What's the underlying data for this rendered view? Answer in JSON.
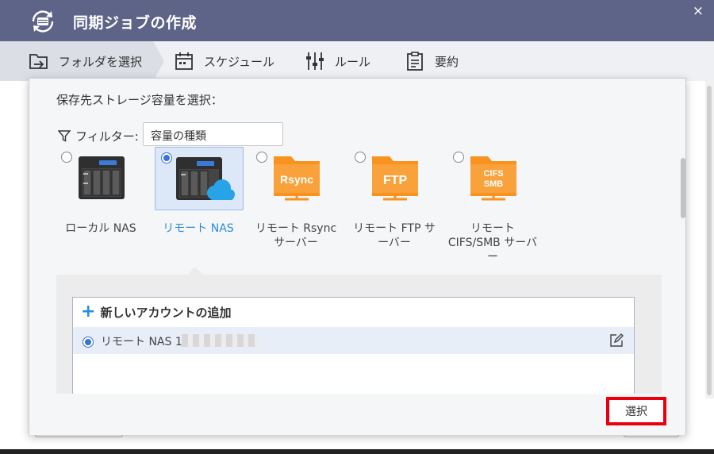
{
  "window": {
    "title": "同期ジョブの作成",
    "close_glyph": "×"
  },
  "steps": [
    {
      "label": "フォルダを選択",
      "icon": "folder-select-icon",
      "active": true
    },
    {
      "label": "スケジュール",
      "icon": "calendar-icon",
      "active": false
    },
    {
      "label": "ルール",
      "icon": "sliders-icon",
      "active": false
    },
    {
      "label": "要約",
      "icon": "clipboard-icon",
      "active": false
    }
  ],
  "dialog": {
    "heading": "保存先ストレージ容量を選択：",
    "filter": {
      "label": "フィルター:",
      "value": "容量の種類"
    },
    "options": [
      {
        "label": "ローカル NAS",
        "selected": false,
        "icon": "nas-icon"
      },
      {
        "label": "リモート NAS",
        "selected": true,
        "icon": "nas-cloud-icon"
      },
      {
        "label_line1": "リモート Rsync",
        "label_line2": "サーバー",
        "badge": "Rsync",
        "selected": false,
        "icon": "rsync-folder-icon"
      },
      {
        "label_line1": "リモート FTP サ",
        "label_line2": "ーバー",
        "badge": "FTP",
        "selected": false,
        "icon": "ftp-folder-icon"
      },
      {
        "label_line1": "リモート",
        "label_line2": "CIFS/SMB サーバ",
        "label_line3": "ー",
        "badge_line1": "CIFS",
        "badge_line2": "SMB",
        "selected": false,
        "icon": "cifs-smb-folder-icon"
      }
    ],
    "accounts": {
      "add_label": "新しいアカウントの追加",
      "items": [
        {
          "name": "リモート NAS 1",
          "selected": true
        }
      ]
    },
    "select_button": "選択"
  },
  "colors": {
    "titlebar": "#5e6488",
    "accent_blue": "#2b8be0",
    "orange": "#f7931e",
    "highlight_red": "#e8000f"
  }
}
